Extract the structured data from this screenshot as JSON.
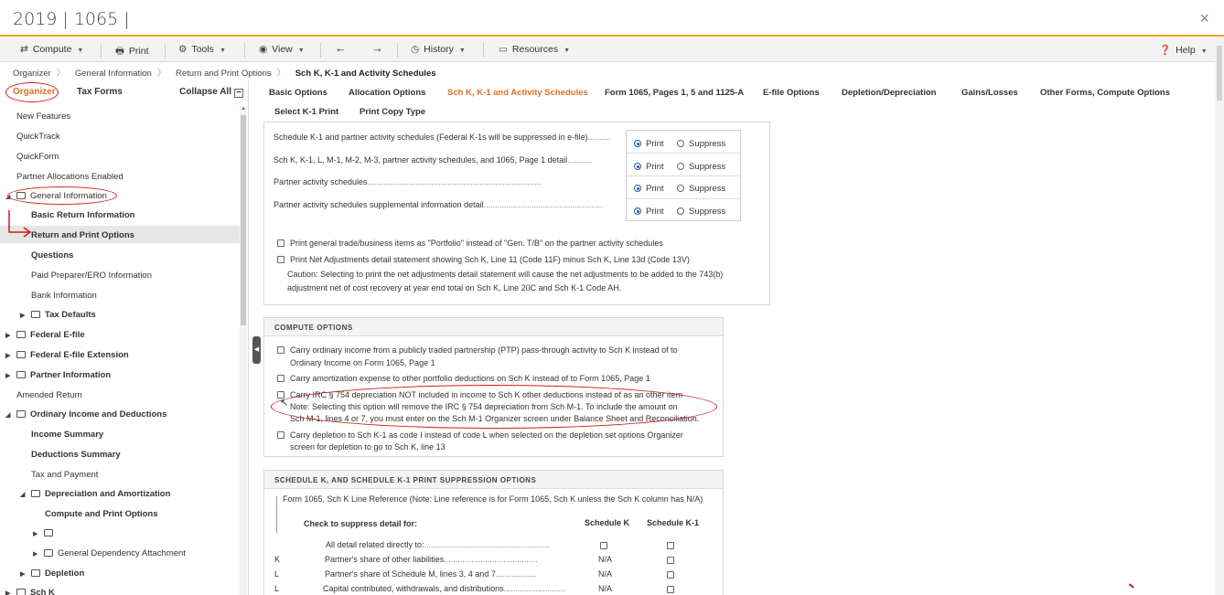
{
  "window": {
    "title": "2019 | 1065 |",
    "close": "×"
  },
  "toolbar": {
    "compute": "Compute",
    "print": "Print",
    "tools": "Tools",
    "view": "View",
    "history": "History",
    "resources": "Resources",
    "help": "Help"
  },
  "breadcrumb": [
    "Organizer",
    "General Information",
    "Return and Print Options",
    "Sch K, K-1 and Activity Schedules"
  ],
  "left": {
    "tabs": {
      "organizer": "Organizer",
      "tax_forms": "Tax Forms",
      "collapse": "Collapse All"
    },
    "tree": [
      "New Features",
      "QuickTrack",
      "QuickForm",
      "Partner Allocations Enabled",
      "General Information",
      "Basic Return Information",
      "Return and Print Options",
      "Questions",
      "Paid Preparer/ERO Information",
      "Bank Information",
      "Tax Defaults",
      "Federal E-file",
      "Federal E-file Extension",
      "Partner Information",
      "Amended Return",
      "Ordinary Income and Deductions",
      "Income Summary",
      "Deductions Summary",
      "Tax and Payment",
      "Depreciation and Amortization",
      "Compute and Print Options",
      "",
      "General Dependency Attachment",
      "Depletion",
      "Sch K"
    ]
  },
  "tabs_row1": [
    "Basic Options",
    "Allocation Options",
    "Sch K, K-1 and Activity Schedules",
    "Form 1065, Pages 1, 5 and 1125-A",
    "E-file Options",
    "Depletion/Depreciation",
    "Gains/Losses",
    "Other Forms, Compute Options"
  ],
  "tabs_row2": [
    "Select K-1 Print",
    "Print Copy Type"
  ],
  "print_rows": [
    "Schedule K-1 and partner activity schedules (Federal K-1s will be suppressed in e-file)",
    "Sch K, K-1, L, M-1, M-2, M-3, partner activity schedules, and 1065, Page 1 detail",
    "Partner activity schedules",
    "Partner activity schedules supplemental information detail"
  ],
  "radio": {
    "print": "Print",
    "suppress": "Suppress"
  },
  "print_checks": {
    "portfolio": "Print general trade/business items as \"Portfolio\" instead of \"Gen. T/B\" on the partner activity schedules",
    "net_adj": "Print Net Adjustments detail statement showing Sch K, Line 11 (Code 11F) minus Sch K, Line 13d (Code 13V)",
    "caution1": "Caution: Selecting to print the net adjustments detail statement will cause the net adjustments to be added to the 743(b)",
    "caution2": "adjustment net of cost recovery at year end total on Sch K, Line 20C and Sch K-1 Code AH."
  },
  "compute": {
    "header": "COMPUTE OPTIONS",
    "ptp1": "Carry ordinary income from a publicly traded partnership (PTP) pass-through activity to Sch K instead of to",
    "ptp2": "Ordinary Income on Form 1065, Page 1",
    "amort": "Carry amortization expense to other portfolio deductions on Sch K instead of to Form 1065, Page 1",
    "irc1": "Carry IRC § 754 depreciation NOT included in income to Sch K other deductions instead of as an other item",
    "irc2": "Note: Selecting this option will remove the IRC § 754 depreciation from Sch M-1. To include the amount on",
    "irc3": "Sch M-1, lines 4 or 7, you must enter on the Sch M-1 Organizer screen under Balance Sheet and Reconciliation.",
    "depl1": "Carry depletion to Sch K-1 as code I instead of code L when selected on the depletion set options Organizer",
    "depl2": "screen for depletion to go to Sch K, line 13"
  },
  "suppression": {
    "header": "SCHEDULE K, AND SCHEDULE K-1 PRINT SUPPRESSION OPTIONS",
    "ref": "Form 1065, Sch K Line Reference (Note: Line reference is for Form 1065, Sch K unless the Sch K column has N/A)",
    "check_label": "Check to suppress detail for:",
    "col_k": "Schedule K",
    "col_k1": "Schedule K-1",
    "rows": [
      {
        "ref": "",
        "label": "All detail related directly to:",
        "k": "checkbox"
      },
      {
        "ref": "K",
        "label": "Partner's share of other liabilities",
        "k": "N/A"
      },
      {
        "ref": "L",
        "label": "Partner's share of Schedule M, lines 3, 4 and 7",
        "k": "N/A"
      },
      {
        "ref": "L",
        "label": "Capital contributed, withdrawals, and distributions",
        "k": "N/A"
      }
    ]
  },
  "colors": {
    "accent": "#e07020",
    "annotation": "#d01a1a",
    "radio": "#1a5ab5"
  }
}
